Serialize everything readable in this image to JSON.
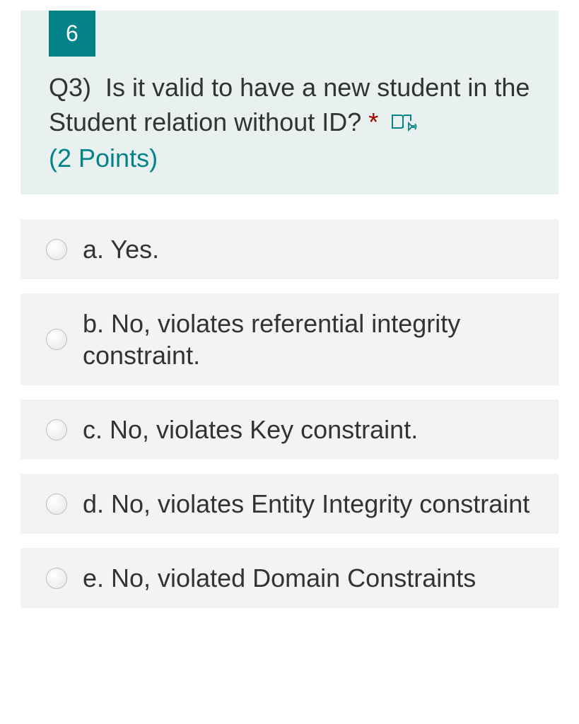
{
  "question": {
    "number": "6",
    "prefix": "Q3)",
    "text": "Is it valid to have a new student in the Student relation without ID?",
    "required": "*",
    "points": "(2 Points)"
  },
  "options": [
    {
      "label": "a. Yes."
    },
    {
      "label": "b. No, violates referential integrity constraint."
    },
    {
      "label": "c. No, violates Key constraint."
    },
    {
      "label": "d. No, violates Entity Integrity constraint"
    },
    {
      "label": "e. No, violated Domain Constraints"
    }
  ]
}
